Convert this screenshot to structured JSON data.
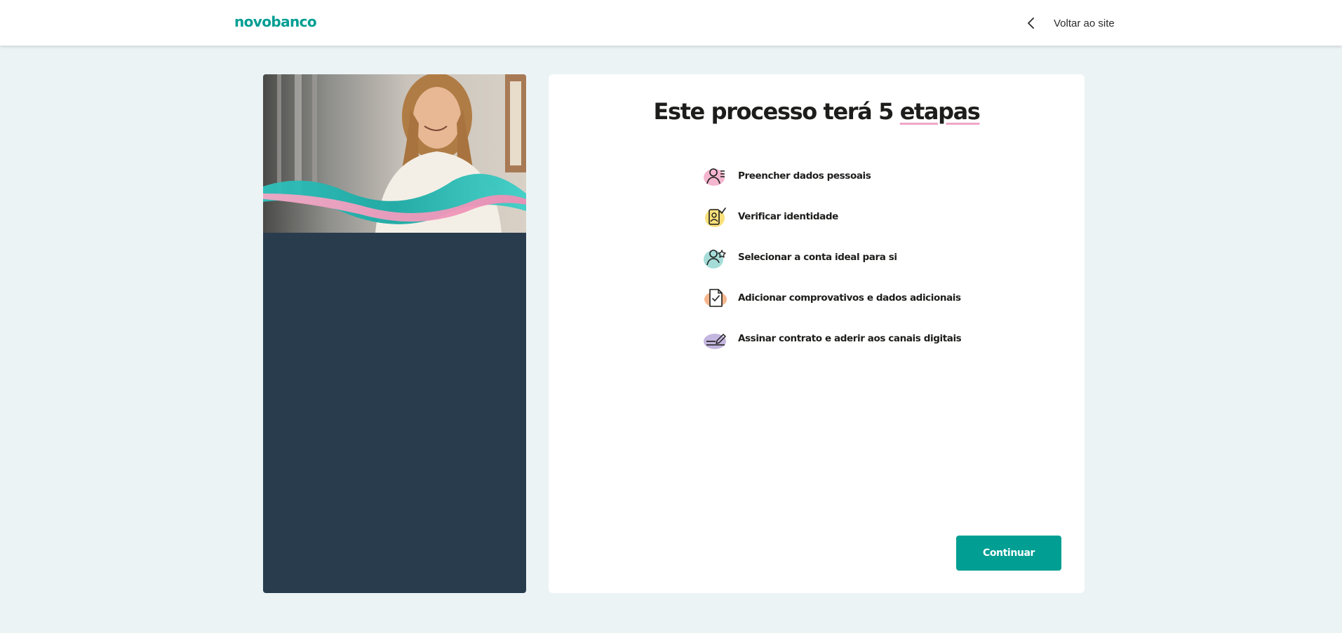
{
  "header": {
    "logo": "novobanco",
    "back_label": "Voltar ao site"
  },
  "main": {
    "title_prefix": "Este processo terá 5 ",
    "title_highlight": "etapas",
    "steps": [
      {
        "label": "Preencher dados pessoais",
        "icon": "personal-data-icon",
        "blob_color": "#f4b6cf"
      },
      {
        "label": "Verificar identidade",
        "icon": "verify-identity-icon",
        "blob_color": "#f9e07a"
      },
      {
        "label": "Selecionar a conta ideal para si",
        "icon": "select-account-icon",
        "blob_color": "#a5dcd8"
      },
      {
        "label": "Adicionar comprovativos e dados adicionais",
        "icon": "add-documents-icon",
        "blob_color": "#f6b58c"
      },
      {
        "label": "Assinar contrato e aderir aos canais digitais",
        "icon": "sign-contract-icon",
        "blob_color": "#c3b6df"
      }
    ],
    "continue_label": "Continuar"
  },
  "colors": {
    "brand": "#009e93",
    "panel": "#283c4d",
    "background": "#ecf3f5"
  }
}
